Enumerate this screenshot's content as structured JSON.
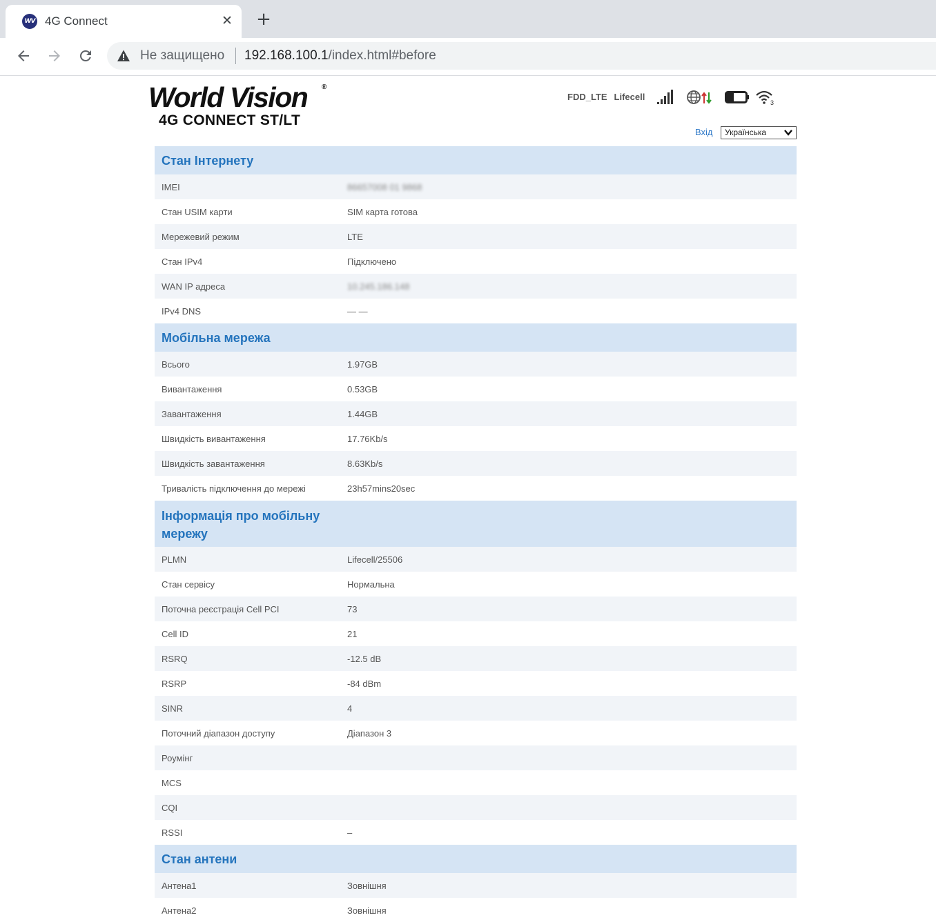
{
  "browser": {
    "tab_title": "4G Connect",
    "favicon_text": "WV",
    "close_glyph": "✕",
    "new_tab_glyph": "+",
    "security_label": "Не защищено",
    "url_host": "192.168.100.1",
    "url_path": "/index.html#before"
  },
  "header": {
    "logo_main": "World Vision",
    "logo_reg": "®",
    "logo_sub": "4G CONNECT ST/LT",
    "network_mode": "FDD_LTE",
    "operator": "Lifecell",
    "login": "Вхід",
    "language": "Українська",
    "icons": [
      "signal-bars-icon",
      "globe-data-icon",
      "battery-icon",
      "wifi-icon"
    ],
    "accent_color": "#2474bd",
    "header_bg": "#d5e4f4"
  },
  "sections": {
    "internet": {
      "title": "Стан Інтернету",
      "rows": [
        {
          "label": "IMEI",
          "value": "86657008 01 9868"
        },
        {
          "label": "Стан USIM карти",
          "value": "SIM карта готова"
        },
        {
          "label": "Мережевий режим",
          "value": "LTE"
        },
        {
          "label": "Стан IPv4",
          "value": "Підключено"
        },
        {
          "label": "WAN IP адреса",
          "value": "10.245.186.148"
        },
        {
          "label": "IPv4 DNS",
          "value": "— —"
        }
      ]
    },
    "mobile": {
      "title": "Мобільна мережа",
      "rows": [
        {
          "label": "Всього",
          "value": "1.97GB"
        },
        {
          "label": "Вивантаження",
          "value": "0.53GB"
        },
        {
          "label": "Завантаження",
          "value": "1.44GB"
        },
        {
          "label": "Швидкість вивантаження",
          "value": "17.76Kb/s"
        },
        {
          "label": "Швидкість завантаження",
          "value": "8.63Kb/s"
        },
        {
          "label": "Тривалість підключення до мережі",
          "value": "23h57mins20sec"
        }
      ]
    },
    "info": {
      "title": "Інформація про мобільну мережу",
      "rows": [
        {
          "label": "PLMN",
          "value": "Lifecell/25506"
        },
        {
          "label": "Стан сервісу",
          "value": "Нормальна"
        },
        {
          "label": "Поточна реєстрація Cell PCI",
          "value": "73"
        },
        {
          "label": "Cell ID",
          "value": "21"
        },
        {
          "label": "RSRQ",
          "value": "-12.5 dB"
        },
        {
          "label": "RSRP",
          "value": "-84 dBm"
        },
        {
          "label": "SINR",
          "value": "4"
        },
        {
          "label": "Поточний діапазон доступу",
          "value": "Діапазон 3"
        },
        {
          "label": "Роумінг",
          "value": ""
        },
        {
          "label": "MCS",
          "value": ""
        },
        {
          "label": "CQI",
          "value": ""
        },
        {
          "label": "RSSI",
          "value": "–"
        }
      ]
    },
    "antenna": {
      "title": "Стан антени",
      "rows": [
        {
          "label": "Антена1",
          "value": "Зовнішня"
        },
        {
          "label": "Антена2",
          "value": "Зовнішня"
        }
      ]
    }
  }
}
